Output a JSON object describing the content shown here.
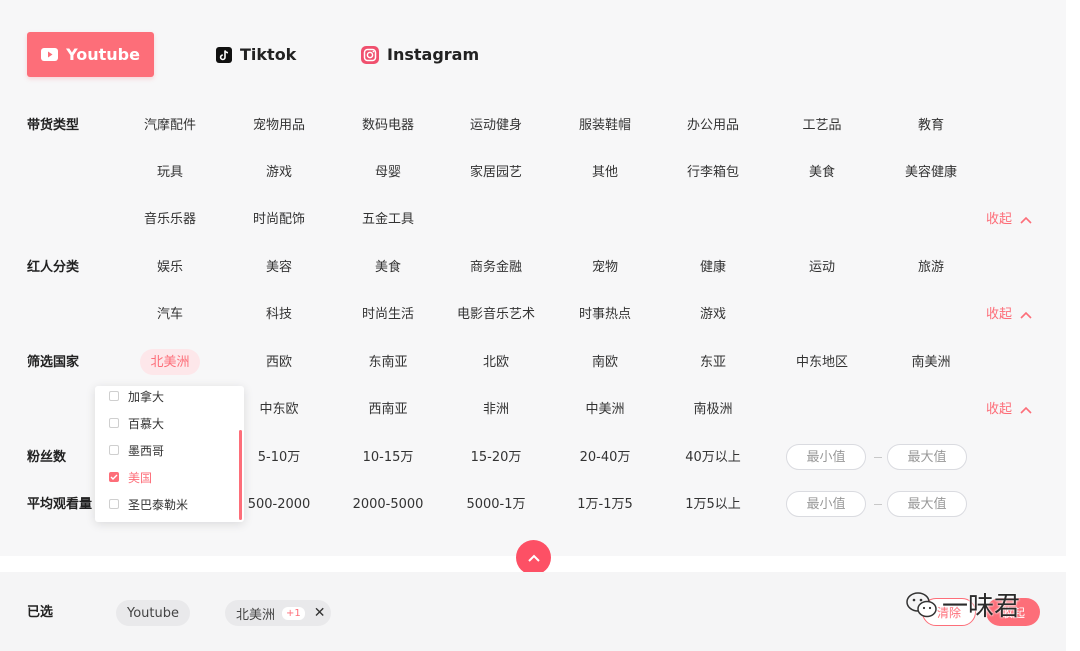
{
  "platform_tabs": {
    "youtube": "Youtube",
    "tiktok": "Tiktok",
    "instagram": "Instagram"
  },
  "categories": {
    "label": "带货类型",
    "items": [
      "汽摩配件",
      "宠物用品",
      "数码电器",
      "运动健身",
      "服装鞋帽",
      "办公用品",
      "工艺品",
      "教育",
      "玩具",
      "游戏",
      "母婴",
      "家居园艺",
      "其他",
      "行李箱包",
      "美食",
      "美容健康",
      "音乐乐器",
      "时尚配饰",
      "五金工具"
    ],
    "collapse": "收起"
  },
  "influencer_types": {
    "label": "红人分类",
    "items": [
      "娱乐",
      "美容",
      "美食",
      "商务金融",
      "宠物",
      "健康",
      "运动",
      "旅游",
      "汽车",
      "科技",
      "时尚生活",
      "电影音乐艺术",
      "时事热点",
      "游戏"
    ],
    "collapse": "收起"
  },
  "countries": {
    "label": "筛选国家",
    "items": [
      "北美洲",
      "西欧",
      "东南亚",
      "北欧",
      "南欧",
      "东亚",
      "中东地区",
      "南美洲",
      "中东欧",
      "西南亚",
      "非洲",
      "中美洲",
      "南极洲"
    ],
    "collapse": "收起"
  },
  "country_dropdown": {
    "items": [
      {
        "label": "加拿大",
        "checked": false
      },
      {
        "label": "百慕大",
        "checked": false
      },
      {
        "label": "墨西哥",
        "checked": false
      },
      {
        "label": "美国",
        "checked": true
      },
      {
        "label": "圣巴泰勒米",
        "checked": false
      }
    ]
  },
  "followers": {
    "label": "粉丝数",
    "items": [
      "5-10万",
      "10-15万",
      "15-20万",
      "20-40万",
      "40万以上"
    ],
    "min_placeholder": "最小值",
    "max_placeholder": "最大值"
  },
  "avg_views": {
    "label": "平均观看量",
    "items": [
      "500-2000",
      "2000-5000",
      "5000-1万",
      "1万-1万5",
      "1万5以上"
    ],
    "min_placeholder": "最小值",
    "max_placeholder": "最大值"
  },
  "selected_bar": {
    "label": "已选",
    "chips": [
      {
        "label": "Youtube"
      },
      {
        "label": "北美洲",
        "badge": "+1"
      }
    ],
    "clear_button": "清除",
    "collapse_button": "收起"
  },
  "watermark": "一味君",
  "colors": {
    "accent": "#fd6e79",
    "fab": "#fd5065",
    "panel": "#f7f7f8"
  }
}
